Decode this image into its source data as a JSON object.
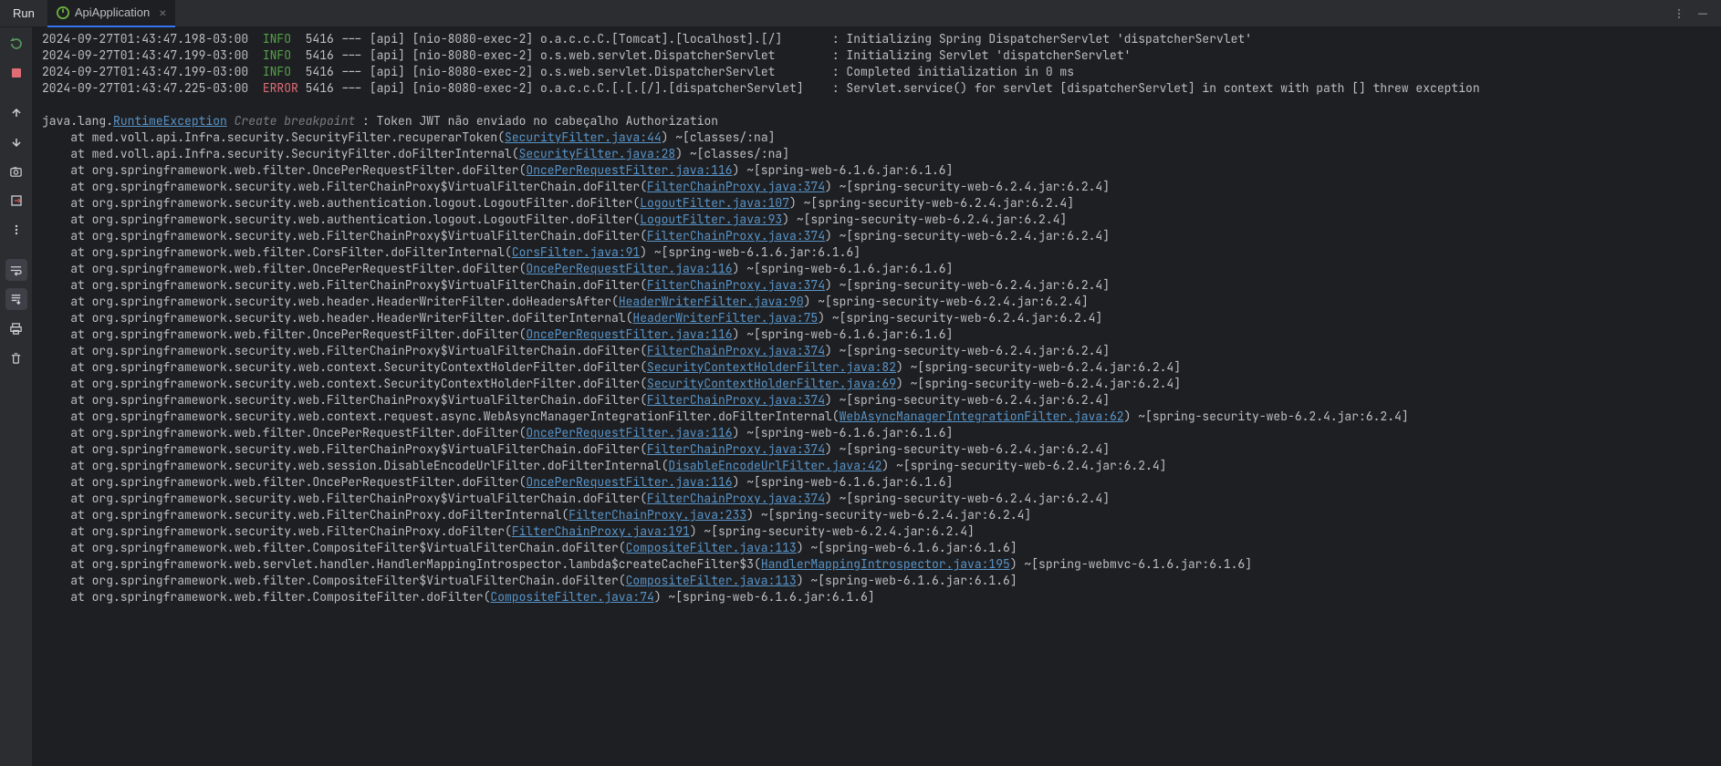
{
  "tab_bar": {
    "run_label": "Run",
    "tab_name": "ApiApplication",
    "close_glyph": "×"
  },
  "left_tools": {
    "rerun": "rerun-icon",
    "stop": "stop-icon",
    "up": "arrow-up-icon",
    "down": "arrow-down-icon",
    "camera": "camera-icon",
    "export": "export-icon",
    "more": "more-vert-icon",
    "wrap": "soft-wrap-icon",
    "scroll": "scroll-to-end-icon",
    "print": "print-icon",
    "trash": "trash-icon"
  },
  "log_lines": [
    {
      "ts": "2024-09-27T01:43:47.198-03:00",
      "lvl": "INFO",
      "pid": "5416",
      "ctx": "--- [api] [nio-8080-exec-2] o.a.c.c.C.[Tomcat].[localhost].[/]      ",
      "msg": ": Initializing Spring DispatcherServlet 'dispatcherServlet'"
    },
    {
      "ts": "2024-09-27T01:43:47.199-03:00",
      "lvl": "INFO",
      "pid": "5416",
      "ctx": "--- [api] [nio-8080-exec-2] o.s.web.servlet.DispatcherServlet       ",
      "msg": ": Initializing Servlet 'dispatcherServlet'"
    },
    {
      "ts": "2024-09-27T01:43:47.199-03:00",
      "lvl": "INFO",
      "pid": "5416",
      "ctx": "--- [api] [nio-8080-exec-2] o.s.web.servlet.DispatcherServlet       ",
      "msg": ": Completed initialization in 0 ms"
    },
    {
      "ts": "2024-09-27T01:43:47.225-03:00",
      "lvl": "ERROR",
      "pid": "5416",
      "ctx": "--- [api] [nio-8080-exec-2] o.a.c.c.C.[.[.[/].[dispatcherServlet]   ",
      "msg": ": Servlet.service() for servlet [dispatcherServlet] in context with path [] threw exception"
    }
  ],
  "exception": {
    "prefix": "java.lang.",
    "class_link": "RuntimeException",
    "breakpoint_label": "Create breakpoint",
    "message": " : Token JWT não enviado no cabeçalho Authorization"
  },
  "stack": [
    {
      "pre": "    at med.voll.api.Infra.security.SecurityFilter.recuperarToken(",
      "link": "SecurityFilter.java:44",
      "post": ") ~[classes/:na]"
    },
    {
      "pre": "    at med.voll.api.Infra.security.SecurityFilter.doFilterInternal(",
      "link": "SecurityFilter.java:28",
      "post": ") ~[classes/:na]"
    },
    {
      "pre": "    at org.springframework.web.filter.OncePerRequestFilter.doFilter(",
      "link": "OncePerRequestFilter.java:116",
      "post": ") ~[spring-web-6.1.6.jar:6.1.6]"
    },
    {
      "pre": "    at org.springframework.security.web.FilterChainProxy$VirtualFilterChain.doFilter(",
      "link": "FilterChainProxy.java:374",
      "post": ") ~[spring-security-web-6.2.4.jar:6.2.4]"
    },
    {
      "pre": "    at org.springframework.security.web.authentication.logout.LogoutFilter.doFilter(",
      "link": "LogoutFilter.java:107",
      "post": ") ~[spring-security-web-6.2.4.jar:6.2.4]"
    },
    {
      "pre": "    at org.springframework.security.web.authentication.logout.LogoutFilter.doFilter(",
      "link": "LogoutFilter.java:93",
      "post": ") ~[spring-security-web-6.2.4.jar:6.2.4]"
    },
    {
      "pre": "    at org.springframework.security.web.FilterChainProxy$VirtualFilterChain.doFilter(",
      "link": "FilterChainProxy.java:374",
      "post": ") ~[spring-security-web-6.2.4.jar:6.2.4]"
    },
    {
      "pre": "    at org.springframework.web.filter.CorsFilter.doFilterInternal(",
      "link": "CorsFilter.java:91",
      "post": ") ~[spring-web-6.1.6.jar:6.1.6]"
    },
    {
      "pre": "    at org.springframework.web.filter.OncePerRequestFilter.doFilter(",
      "link": "OncePerRequestFilter.java:116",
      "post": ") ~[spring-web-6.1.6.jar:6.1.6]"
    },
    {
      "pre": "    at org.springframework.security.web.FilterChainProxy$VirtualFilterChain.doFilter(",
      "link": "FilterChainProxy.java:374",
      "post": ") ~[spring-security-web-6.2.4.jar:6.2.4]"
    },
    {
      "pre": "    at org.springframework.security.web.header.HeaderWriterFilter.doHeadersAfter(",
      "link": "HeaderWriterFilter.java:90",
      "post": ") ~[spring-security-web-6.2.4.jar:6.2.4]"
    },
    {
      "pre": "    at org.springframework.security.web.header.HeaderWriterFilter.doFilterInternal(",
      "link": "HeaderWriterFilter.java:75",
      "post": ") ~[spring-security-web-6.2.4.jar:6.2.4]"
    },
    {
      "pre": "    at org.springframework.web.filter.OncePerRequestFilter.doFilter(",
      "link": "OncePerRequestFilter.java:116",
      "post": ") ~[spring-web-6.1.6.jar:6.1.6]"
    },
    {
      "pre": "    at org.springframework.security.web.FilterChainProxy$VirtualFilterChain.doFilter(",
      "link": "FilterChainProxy.java:374",
      "post": ") ~[spring-security-web-6.2.4.jar:6.2.4]"
    },
    {
      "pre": "    at org.springframework.security.web.context.SecurityContextHolderFilter.doFilter(",
      "link": "SecurityContextHolderFilter.java:82",
      "post": ") ~[spring-security-web-6.2.4.jar:6.2.4]"
    },
    {
      "pre": "    at org.springframework.security.web.context.SecurityContextHolderFilter.doFilter(",
      "link": "SecurityContextHolderFilter.java:69",
      "post": ") ~[spring-security-web-6.2.4.jar:6.2.4]"
    },
    {
      "pre": "    at org.springframework.security.web.FilterChainProxy$VirtualFilterChain.doFilter(",
      "link": "FilterChainProxy.java:374",
      "post": ") ~[spring-security-web-6.2.4.jar:6.2.4]"
    },
    {
      "pre": "    at org.springframework.security.web.context.request.async.WebAsyncManagerIntegrationFilter.doFilterInternal(",
      "link": "WebAsyncManagerIntegrationFilter.java:62",
      "post": ") ~[spring-security-web-6.2.4.jar:6.2.4]"
    },
    {
      "pre": "    at org.springframework.web.filter.OncePerRequestFilter.doFilter(",
      "link": "OncePerRequestFilter.java:116",
      "post": ") ~[spring-web-6.1.6.jar:6.1.6]"
    },
    {
      "pre": "    at org.springframework.security.web.FilterChainProxy$VirtualFilterChain.doFilter(",
      "link": "FilterChainProxy.java:374",
      "post": ") ~[spring-security-web-6.2.4.jar:6.2.4]"
    },
    {
      "pre": "    at org.springframework.security.web.session.DisableEncodeUrlFilter.doFilterInternal(",
      "link": "DisableEncodeUrlFilter.java:42",
      "post": ") ~[spring-security-web-6.2.4.jar:6.2.4]"
    },
    {
      "pre": "    at org.springframework.web.filter.OncePerRequestFilter.doFilter(",
      "link": "OncePerRequestFilter.java:116",
      "post": ") ~[spring-web-6.1.6.jar:6.1.6]"
    },
    {
      "pre": "    at org.springframework.security.web.FilterChainProxy$VirtualFilterChain.doFilter(",
      "link": "FilterChainProxy.java:374",
      "post": ") ~[spring-security-web-6.2.4.jar:6.2.4]"
    },
    {
      "pre": "    at org.springframework.security.web.FilterChainProxy.doFilterInternal(",
      "link": "FilterChainProxy.java:233",
      "post": ") ~[spring-security-web-6.2.4.jar:6.2.4]"
    },
    {
      "pre": "    at org.springframework.security.web.FilterChainProxy.doFilter(",
      "link": "FilterChainProxy.java:191",
      "post": ") ~[spring-security-web-6.2.4.jar:6.2.4]"
    },
    {
      "pre": "    at org.springframework.web.filter.CompositeFilter$VirtualFilterChain.doFilter(",
      "link": "CompositeFilter.java:113",
      "post": ") ~[spring-web-6.1.6.jar:6.1.6]"
    },
    {
      "pre": "    at org.springframework.web.servlet.handler.HandlerMappingIntrospector.lambda$createCacheFilter$3(",
      "link": "HandlerMappingIntrospector.java:195",
      "post": ") ~[spring-webmvc-6.1.6.jar:6.1.6]"
    },
    {
      "pre": "    at org.springframework.web.filter.CompositeFilter$VirtualFilterChain.doFilter(",
      "link": "CompositeFilter.java:113",
      "post": ") ~[spring-web-6.1.6.jar:6.1.6]"
    },
    {
      "pre": "    at org.springframework.web.filter.CompositeFilter.doFilter(",
      "link": "CompositeFilter.java:74",
      "post": ") ~[spring-web-6.1.6.jar:6.1.6]"
    }
  ]
}
